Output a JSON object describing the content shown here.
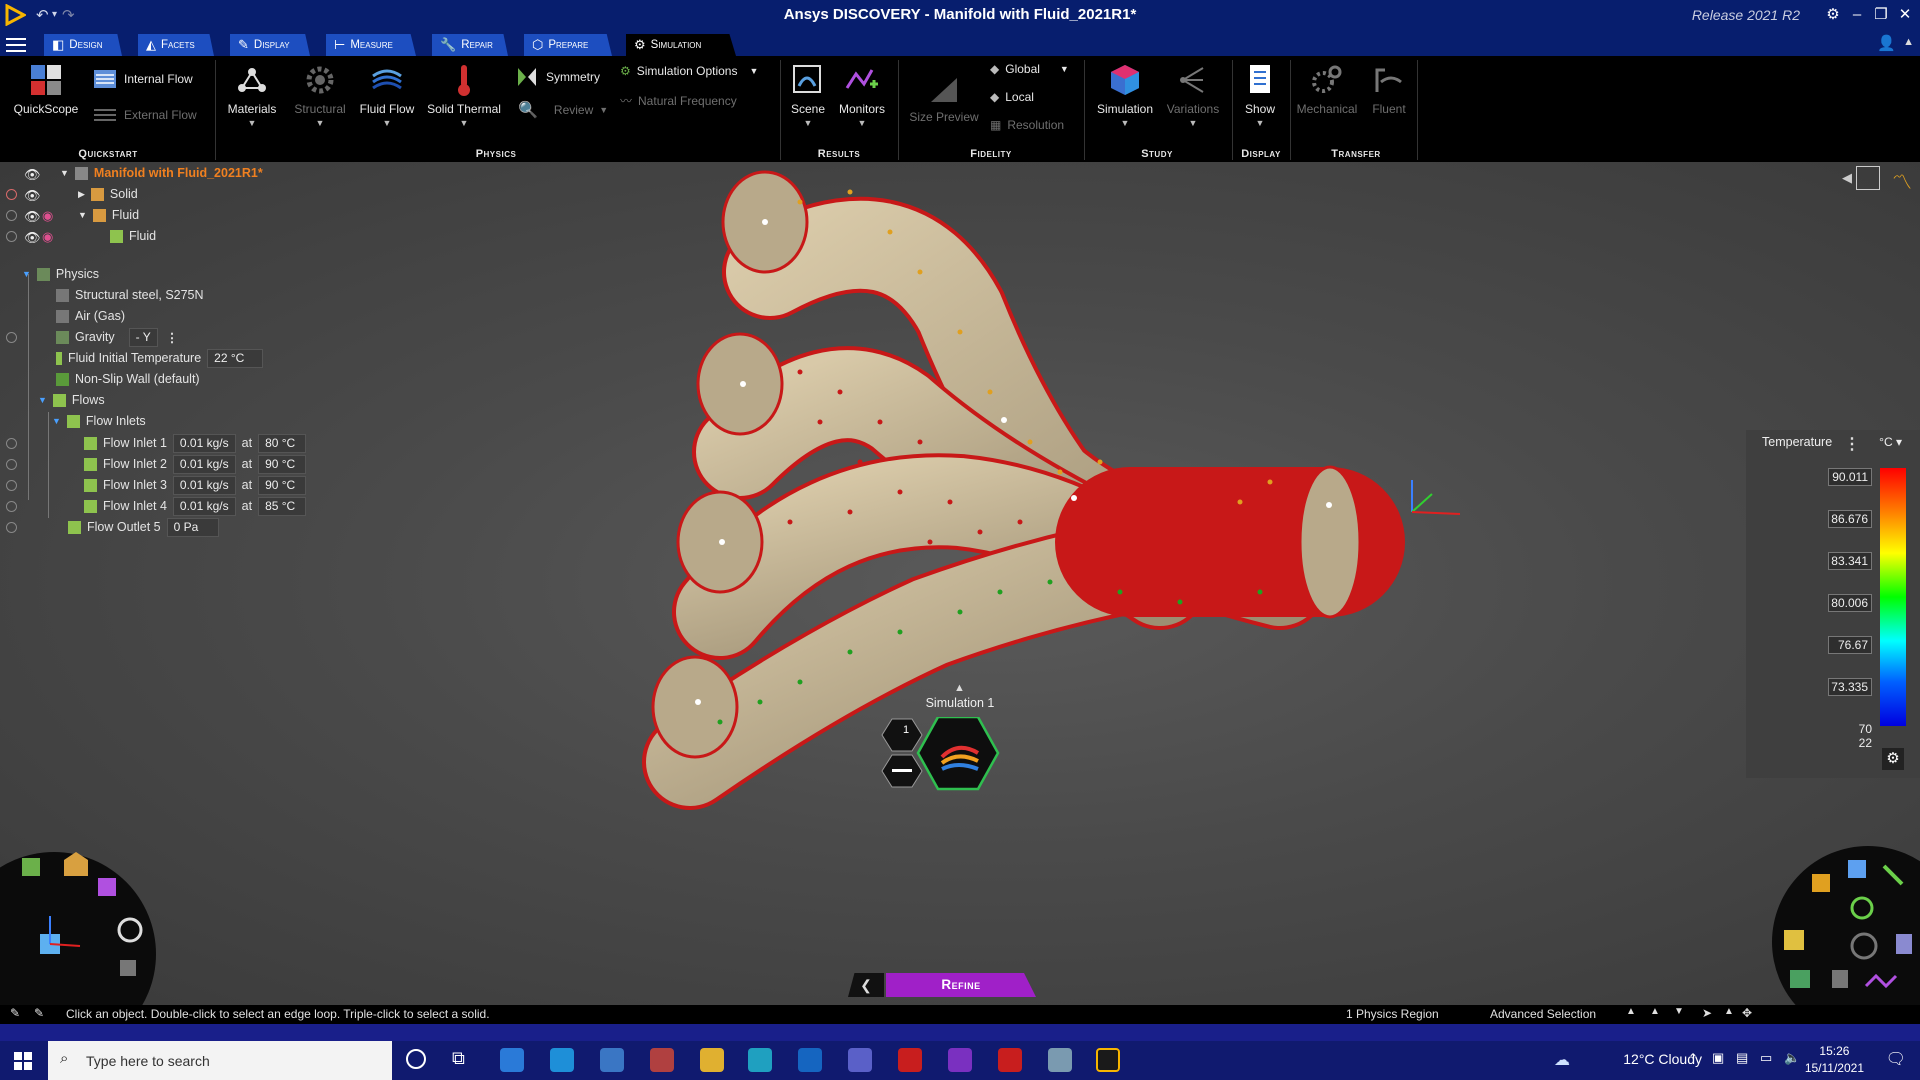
{
  "window": {
    "title": "Ansys DISCOVERY - Manifold with Fluid_2021R1*",
    "release": "Release 2021 R2"
  },
  "tabs": [
    {
      "label": "Design",
      "icon": "design-icon"
    },
    {
      "label": "Facets",
      "icon": "facets-icon"
    },
    {
      "label": "Display",
      "icon": "display-icon"
    },
    {
      "label": "Measure",
      "icon": "measure-icon"
    },
    {
      "label": "Repair",
      "icon": "repair-icon"
    },
    {
      "label": "Prepare",
      "icon": "prepare-icon"
    },
    {
      "label": "Simulation",
      "icon": "simulation-icon",
      "active": true
    }
  ],
  "ribbon": {
    "quickstart": {
      "group": "Quickstart",
      "quickscope": "QuickScope",
      "internal_flow": "Internal Flow",
      "external_flow": "External Flow"
    },
    "physics": {
      "group": "Physics",
      "materials": "Materials",
      "structural": "Structural",
      "fluid_flow": "Fluid Flow",
      "solid_thermal": "Solid Thermal",
      "symmetry": "Symmetry",
      "review": "Review",
      "simulation_options": "Simulation Options",
      "natural_frequency": "Natural Frequency"
    },
    "results": {
      "group": "Results",
      "scene": "Scene",
      "monitors": "Monitors"
    },
    "fidelity": {
      "group": "Fidelity",
      "size_preview": "Size Preview",
      "global": "Global",
      "local": "Local",
      "resolution": "Resolution"
    },
    "study": {
      "group": "Study",
      "simulation": "Simulation",
      "variations": "Variations"
    },
    "display": {
      "group": "Display",
      "show": "Show"
    },
    "transfer": {
      "group": "Transfer",
      "mechanical": "Mechanical",
      "fluent": "Fluent"
    }
  },
  "tree": {
    "root": "Manifold with Fluid_2021R1*",
    "solid": "Solid",
    "fluid_group": "Fluid",
    "fluid_body": "Fluid",
    "physics": "Physics",
    "material_1": "Structural steel, S275N",
    "material_2": "Air (Gas)",
    "gravity_label": "Gravity",
    "gravity_value": "- Y",
    "fluid_temp_label": "Fluid Initial Temperature",
    "fluid_temp_value": "22 °C",
    "wall": "Non-Slip Wall (default)",
    "flows": "Flows",
    "flow_inlets": "Flow Inlets",
    "inlets": [
      {
        "name": "Flow Inlet 1",
        "rate": "0.01 kg/s",
        "at": "at",
        "temp": "80 °C"
      },
      {
        "name": "Flow Inlet 2",
        "rate": "0.01 kg/s",
        "at": "at",
        "temp": "90 °C"
      },
      {
        "name": "Flow Inlet 3",
        "rate": "0.01 kg/s",
        "at": "at",
        "temp": "90 °C"
      },
      {
        "name": "Flow Inlet 4",
        "rate": "0.01 kg/s",
        "at": "at",
        "temp": "85 °C"
      }
    ],
    "outlet_name": "Flow Outlet 5",
    "outlet_value": "0 Pa"
  },
  "legend": {
    "title": "Temperature",
    "unit": "°C",
    "values": [
      "90.011",
      "86.676",
      "83.341",
      "80.006",
      "76.67",
      "73.335"
    ],
    "min_a": "70",
    "min_b": "22"
  },
  "simulation_hud": {
    "label": "Simulation 1",
    "badge": "1",
    "refine": "Refine"
  },
  "status": {
    "hint": "Click an object. Double-click to select an edge loop. Triple-click to select a solid.",
    "region": "1 Physics Region",
    "selection": "Advanced Selection"
  },
  "taskbar": {
    "search_placeholder": "Type here to search",
    "weather": "12°C  Cloudy",
    "time": "15:26",
    "date": "15/11/2021"
  },
  "colors": {
    "title_bar": "#071e6e",
    "tab": "#1d4ec0",
    "refine": "#a020c8",
    "hot": "#cc1010",
    "warm": "#e0a020",
    "cool": "#20a020"
  }
}
